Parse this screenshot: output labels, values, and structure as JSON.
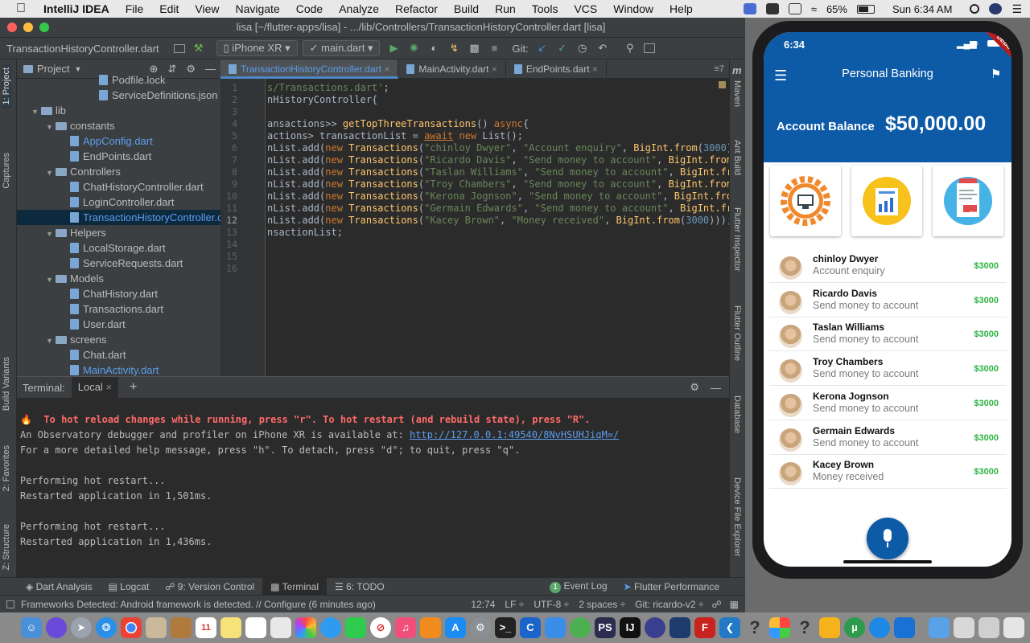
{
  "menubar": {
    "app_name": "IntelliJ IDEA",
    "items": [
      "File",
      "Edit",
      "View",
      "Navigate",
      "Code",
      "Analyze",
      "Refactor",
      "Build",
      "Run",
      "Tools",
      "VCS",
      "Window",
      "Help"
    ],
    "battery": "65%",
    "clock": "Sun 6:34 AM"
  },
  "window": {
    "title": "lisa [~/flutter-apps/lisa] - .../lib/Controllers/TransactionHistoryController.dart [lisa]"
  },
  "navbar": {
    "breadcrumb": "TransactionHistoryController.dart",
    "device": "iPhone XR",
    "run_config": "main.dart",
    "git_label": "Git:"
  },
  "left_stripe": {
    "project": "1: Project",
    "captures": "Captures",
    "build_variants": "Build Variants",
    "favorites": "2: Favorites",
    "structure": "Z: Structure"
  },
  "project_panel": {
    "title": "Project",
    "tree": [
      {
        "label": "Podfile.lock",
        "indent": 5,
        "type": "file",
        "color": "normal"
      },
      {
        "label": "ServiceDefinitions.json",
        "indent": 5,
        "type": "file",
        "color": "normal"
      },
      {
        "label": "lib",
        "indent": 1,
        "type": "folder",
        "color": "normal"
      },
      {
        "label": "constants",
        "indent": 2,
        "type": "folder",
        "color": "normal"
      },
      {
        "label": "AppConfig.dart",
        "indent": 3,
        "type": "file",
        "color": "blue"
      },
      {
        "label": "EndPoints.dart",
        "indent": 3,
        "type": "file",
        "color": "normal"
      },
      {
        "label": "Controllers",
        "indent": 2,
        "type": "folder",
        "color": "normal"
      },
      {
        "label": "ChatHistoryController.dart",
        "indent": 3,
        "type": "file",
        "color": "normal"
      },
      {
        "label": "LoginController.dart",
        "indent": 3,
        "type": "file",
        "color": "normal"
      },
      {
        "label": "TransactionHistoryController.dart",
        "indent": 3,
        "type": "file",
        "color": "blue",
        "selected": true
      },
      {
        "label": "Helpers",
        "indent": 2,
        "type": "folder",
        "color": "normal"
      },
      {
        "label": "LocalStorage.dart",
        "indent": 3,
        "type": "file",
        "color": "normal"
      },
      {
        "label": "ServiceRequests.dart",
        "indent": 3,
        "type": "file",
        "color": "normal"
      },
      {
        "label": "Models",
        "indent": 2,
        "type": "folder",
        "color": "normal"
      },
      {
        "label": "ChatHistory.dart",
        "indent": 3,
        "type": "file",
        "color": "normal"
      },
      {
        "label": "Transactions.dart",
        "indent": 3,
        "type": "file",
        "color": "normal"
      },
      {
        "label": "User.dart",
        "indent": 3,
        "type": "file",
        "color": "normal"
      },
      {
        "label": "screens",
        "indent": 2,
        "type": "folder",
        "color": "normal"
      },
      {
        "label": "Chat.dart",
        "indent": 3,
        "type": "file",
        "color": "normal"
      },
      {
        "label": "MainActivity.dart",
        "indent": 3,
        "type": "file",
        "color": "blue"
      }
    ]
  },
  "editor_tabs": [
    "TransactionHistoryController.dart",
    "MainActivity.dart",
    "EndPoints.dart"
  ],
  "editor_tab_extra": "≡7",
  "code_lines": [
    {
      "n": "1",
      "html": "<span class=\"str\">s/Transactions.dart'</span>;"
    },
    {
      "n": "2",
      "html": "nHistoryController{"
    },
    {
      "n": "3",
      "html": ""
    },
    {
      "n": "4",
      "html": "ansactions&gt;&gt; <span class=\"fn\">getTopThreeTransactions</span>() <span class=\"kw\">async</span>{"
    },
    {
      "n": "5",
      "html": "actions&gt; transactionList = <span class=\"kw\" style=\"text-decoration:underline\">await</span> <span class=\"kw\">new</span> List();"
    },
    {
      "n": "6",
      "html": "nList.add(<span class=\"kw\">new</span> <span class=\"fn\">Transactions</span>(<span class=\"str\">\"chinloy Dwyer\"</span>, <span class=\"str\">\"Account enquiry\"</span>, <span class=\"fn\">BigInt.from</span>(<span class=\"num\">3000</span>)))"
    },
    {
      "n": "7",
      "html": "nList.add(<span class=\"kw\">new</span> <span class=\"fn\">Transactions</span>(<span class=\"str\">\"Ricardo Davis\"</span>, <span class=\"str\">\"Send money to account\"</span>, <span class=\"fn\">BigInt.from</span>(3"
    },
    {
      "n": "8",
      "html": "nList.add(<span class=\"kw\">new</span> <span class=\"fn\">Transactions</span>(<span class=\"str\">\"Taslan Williams\"</span>, <span class=\"str\">\"Send money to account\"</span>, <span class=\"fn\">BigInt.fro</span>"
    },
    {
      "n": "9",
      "html": "nList.add(<span class=\"kw\">new</span> <span class=\"fn\">Transactions</span>(<span class=\"str\">\"Troy Chambers\"</span>, <span class=\"str\">\"Send money to account\"</span>, <span class=\"fn\">BigInt.from</span>(3"
    },
    {
      "n": "10",
      "html": "nList.add(<span class=\"kw\">new</span> <span class=\"fn\">Transactions</span>(<span class=\"str\">\"Kerona Jognson\"</span>, <span class=\"str\">\"Send money to account\"</span>, <span class=\"fn\">BigInt.from</span>("
    },
    {
      "n": "11",
      "html": "nList.add(<span class=\"kw\">new</span> <span class=\"fn\">Transactions</span>(<span class=\"str\">\"Germain Edwards\"</span>, <span class=\"str\">\"Send money to account\"</span>, <span class=\"fn\">BigInt.from</span>"
    },
    {
      "n": "12",
      "html": "nList.add(<span class=\"kw\">new</span> <span class=\"fn\">Transactions</span>(<span class=\"str\">\"Kacey Brown\"</span>, <span class=\"str\">\"Money received\"</span>, <span class=\"fn\">BigInt.from</span>(<span class=\"num\">3000</span>)));"
    },
    {
      "n": "13",
      "html": "nsactionList;"
    },
    {
      "n": "14",
      "html": ""
    },
    {
      "n": "15",
      "html": ""
    },
    {
      "n": "16",
      "html": ""
    }
  ],
  "right_stripe": {
    "maven": "Maven",
    "ant": "Ant Build",
    "flutter_inspector": "Flutter Inspector",
    "flutter_outline": "Flutter Outline",
    "database": "Database",
    "device_file": "Device File Explorer"
  },
  "terminal": {
    "label": "Terminal:",
    "tab": "Local",
    "lines": [
      {
        "text": "🔥  To hot reload changes while running, press \"r\". To hot restart (and rebuild state), press \"R\".",
        "style": "red"
      },
      {
        "pre": "An Observatory debugger and profiler on iPhone XR is available at: ",
        "link": "http://127.0.0.1:49540/8NvHSUHJiqM=/"
      },
      {
        "text": "For a more detailed help message, press \"h\". To detach, press \"d\"; to quit, press \"q\"."
      },
      {
        "text": ""
      },
      {
        "text": "Performing hot restart..."
      },
      {
        "text": "Restarted application in 1,501ms."
      },
      {
        "text": ""
      },
      {
        "text": "Performing hot restart..."
      },
      {
        "text": "Restarted application in 1,436ms."
      }
    ]
  },
  "tool_windows": {
    "dart_analysis": "Dart Analysis",
    "logcat": "Logcat",
    "vcs": "9: Version Control",
    "terminal": "Terminal",
    "todo": "6: TODO",
    "event_log_count": "1",
    "event_log": "Event Log",
    "flutter_perf": "Flutter Performance"
  },
  "status": {
    "message": "Frameworks Detected: Android framework is detected. // Configure (6 minutes ago)",
    "position": "12:74",
    "line_sep": "LF ÷",
    "encoding": "UTF-8 ÷",
    "indent": "2 spaces ÷",
    "git": "Git: ricardo-v2 ÷"
  },
  "phone": {
    "time": "6:34",
    "debug_banner": "DEBUG",
    "app_title": "Personal Banking",
    "balance_label": "Account Balance",
    "balance": "$50,000.00",
    "receipt_amount": "$23",
    "transactions": [
      {
        "name": "chinloy Dwyer",
        "desc": "Account enquiry",
        "amount": "$3000"
      },
      {
        "name": "Ricardo Davis",
        "desc": "Send money to account",
        "amount": "$3000"
      },
      {
        "name": "Taslan Williams",
        "desc": "Send money to account",
        "amount": "$3000"
      },
      {
        "name": "Troy Chambers",
        "desc": "Send money to account",
        "amount": "$3000"
      },
      {
        "name": "Kerona Jognson",
        "desc": "Send money to account",
        "amount": "$3000"
      },
      {
        "name": "Germain Edwards",
        "desc": "Send money to account",
        "amount": "$3000"
      },
      {
        "name": "Kacey Brown",
        "desc": "Money received",
        "amount": "$3000"
      }
    ]
  },
  "colors": {
    "ide_bg": "#2b2b2b",
    "panel_bg": "#3c3f41",
    "accent_blue": "#0d5aa7",
    "amount_green": "#2fb344",
    "terminal_red": "#ff6b68"
  }
}
